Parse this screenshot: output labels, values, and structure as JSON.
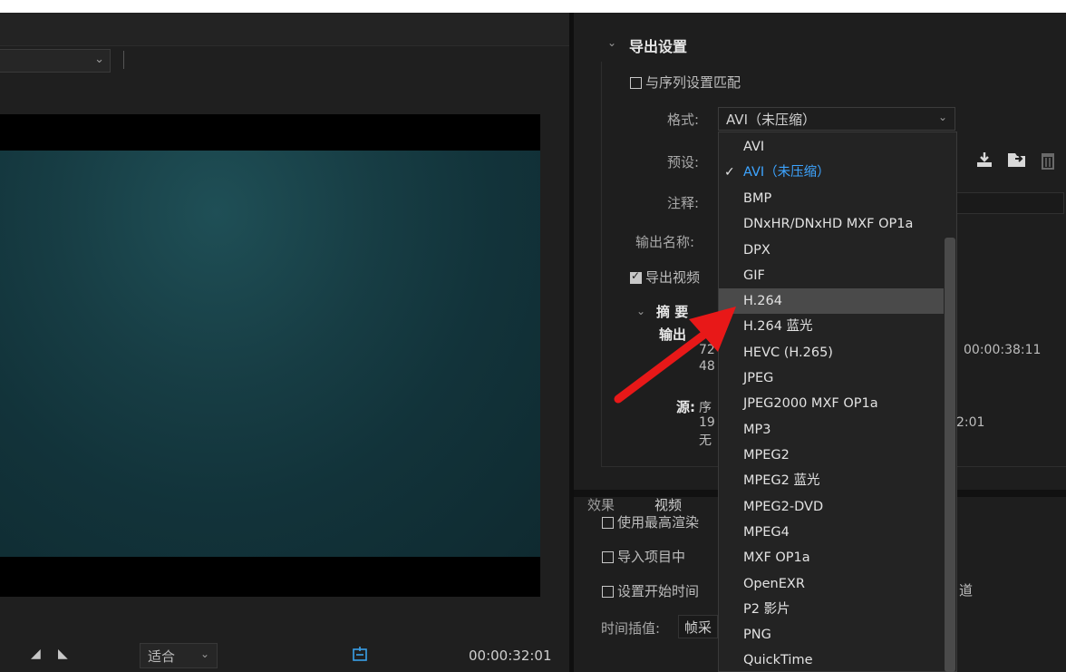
{
  "left_panel": {
    "fit_select": "适合",
    "timecode": "00:00:32:01"
  },
  "export_settings": {
    "title": "导出设置",
    "match_sequence_label": "与序列设置匹配",
    "format_label": "格式:",
    "format_value": "AVI（未压缩）",
    "preset_label": "预设:",
    "comment_label": "注释:",
    "output_name_label": "输出名称:",
    "export_video_label": "导出视频",
    "summary_title": "摘 要",
    "output_label": "输出",
    "output_line1": "72",
    "output_line2": "48",
    "output_duration": "00:00:38:11",
    "source_label": "源:",
    "source_line1": "序",
    "source_line2": "19",
    "source_line3": "无",
    "source_duration": "2:01"
  },
  "tabs": [
    "效果",
    "视频"
  ],
  "options": {
    "max_render_label": "使用最高渲染",
    "import_label": "导入项目中",
    "set_start_label": "设置开始时间",
    "channel_fragment": "道",
    "time_interp_label": "时间插值:",
    "time_interp_value": "帧采"
  },
  "format_menu": {
    "selected": "AVI（未压缩）",
    "highlighted": "H.264",
    "items": [
      "AVI",
      "AVI（未压缩）",
      "BMP",
      "DNxHR/DNxHD MXF OP1a",
      "DPX",
      "GIF",
      "H.264",
      "H.264 蓝光",
      "HEVC (H.265)",
      "JPEG",
      "JPEG2000 MXF OP1a",
      "MP3",
      "MPEG2",
      "MPEG2 蓝光",
      "MPEG2-DVD",
      "MPEG4",
      "MXF OP1a",
      "OpenEXR",
      "P2 影片",
      "PNG",
      "QuickTime"
    ]
  },
  "colors": {
    "accent_blue": "#3da4ff",
    "annotation_red": "#e81818",
    "highlight": "#4a4a4a"
  }
}
